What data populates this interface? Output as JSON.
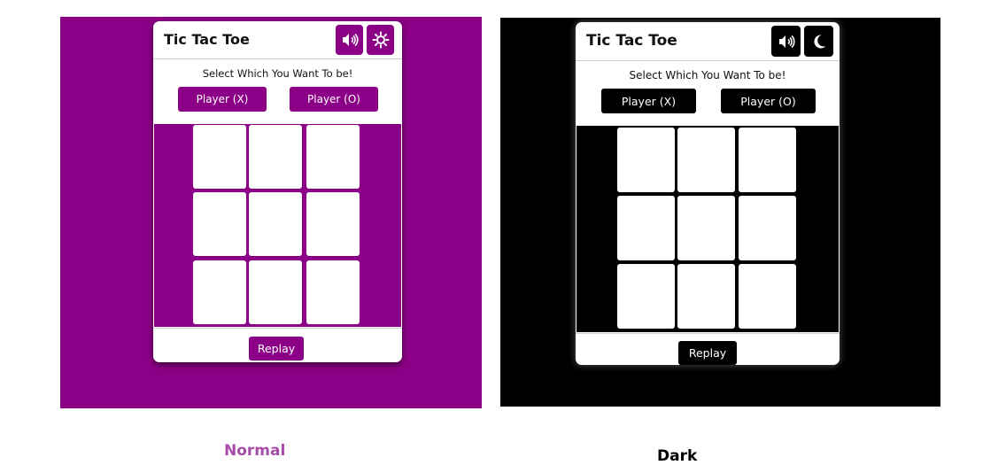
{
  "colors": {
    "normal_accent": "#8b0086",
    "dark_accent": "#000000",
    "card_bg": "#ffffff",
    "normal_caption": "#a64ca6"
  },
  "normal": {
    "title": "Tic Tac Toe",
    "header_icons": [
      "speaker-icon",
      "sun-icon"
    ],
    "select_text": "Select Which You Want To be!",
    "player_x_label": "Player (X)",
    "player_o_label": "Player (O)",
    "replay_label": "Replay",
    "caption": "Normal"
  },
  "dark": {
    "title": "Tic Tac Toe",
    "header_icons": [
      "speaker-icon",
      "moon-icon"
    ],
    "select_text": "Select Which You Want To be!",
    "player_x_label": "Player (X)",
    "player_o_label": "Player (O)",
    "replay_label": "Replay",
    "caption": "Dark"
  }
}
